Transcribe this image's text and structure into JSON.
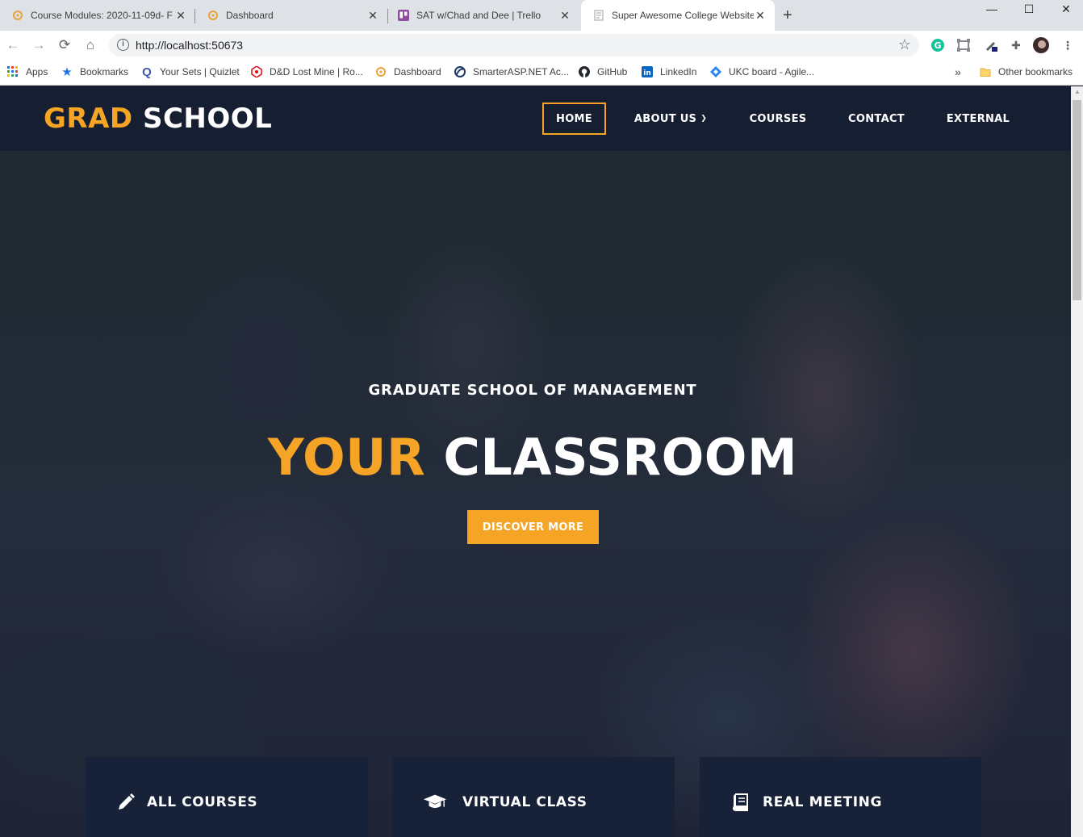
{
  "browser": {
    "tabs": [
      {
        "title": "Course Modules: 2020-11-09d- F",
        "active": false
      },
      {
        "title": "Dashboard",
        "active": false
      },
      {
        "title": "SAT w/Chad and Dee | Trello",
        "active": false
      },
      {
        "title": "Super Awesome College Website",
        "active": true
      }
    ],
    "url": "http://localhost:50673",
    "bookmarks": [
      {
        "label": "Apps",
        "icon": "apps-grid-icon"
      },
      {
        "label": "Bookmarks",
        "icon": "star-icon"
      },
      {
        "label": "Your Sets | Quizlet",
        "icon": "quizlet-icon"
      },
      {
        "label": "D&D Lost Mine | Ro...",
        "icon": "dnd-icon"
      },
      {
        "label": "Dashboard",
        "icon": "dashboard-icon"
      },
      {
        "label": "SmarterASP.NET Ac...",
        "icon": "smarterasp-icon"
      },
      {
        "label": "GitHub",
        "icon": "github-icon"
      },
      {
        "label": "LinkedIn",
        "icon": "linkedin-icon"
      },
      {
        "label": "UKC board - Agile...",
        "icon": "jira-icon"
      }
    ],
    "overflow_label": "»",
    "other_bookmarks": "Other bookmarks"
  },
  "site": {
    "logo": {
      "accent": "GRAD",
      "main": "SCHOOL"
    },
    "nav": [
      {
        "label": "HOME",
        "active": true
      },
      {
        "label": "ABOUT US",
        "active": false
      },
      {
        "label": "COURSES",
        "active": false
      },
      {
        "label": "CONTACT",
        "active": false
      },
      {
        "label": "EXTERNAL",
        "active": false
      }
    ],
    "hero": {
      "subheading": "GRADUATE SCHOOL OF MANAGEMENT",
      "headline_accent": "YOUR",
      "headline_main": "CLASSROOM",
      "cta": "DISCOVER MORE"
    },
    "features": [
      {
        "label": "ALL COURSES",
        "icon": "pencil-icon"
      },
      {
        "label": "VIRTUAL CLASS",
        "icon": "graduation-cap-icon"
      },
      {
        "label": "REAL MEETING",
        "icon": "book-icon"
      }
    ]
  },
  "colors": {
    "accent": "#f5a425",
    "header_bg": "#161d32",
    "feature_bg": "#172238"
  }
}
